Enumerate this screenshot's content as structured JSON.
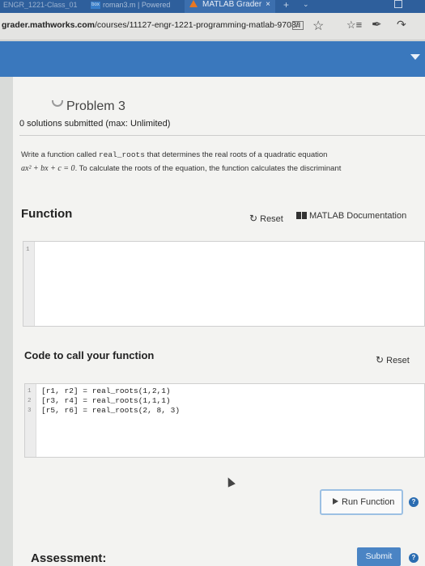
{
  "browser": {
    "tabs": [
      {
        "label": "ENGR_1221-Class_01"
      },
      {
        "icon_label": "box",
        "label": "roman3.m | Powered"
      },
      {
        "label": "MATLAB Grader"
      }
    ],
    "active_tab_close": "×",
    "new_tab": "+",
    "url_host": "grader.mathworks.com",
    "url_path": "/courses/11127-engr-1221-programming-matlab-9708/i"
  },
  "problem": {
    "title": "Problem 3",
    "solutions": "0 solutions submitted (max: Unlimited)",
    "description_prefix": "Write a function called ",
    "function_name": "real_roots",
    "description_suffix": " that determines the real roots of a quadratic equation",
    "equation": "ax² + bx + c = 0",
    "description_line2": ". To calculate the roots of the equation, the function calculates the discriminant"
  },
  "function_section": {
    "title": "Function",
    "reset_label": "Reset",
    "docs_label": "MATLAB Documentation",
    "line_numbers": [
      "1"
    ]
  },
  "call_section": {
    "title": "Code to call your function",
    "reset_label": "Reset",
    "lines": [
      {
        "num": "1",
        "code": "[r1, r2] = real_roots(1,2,1)"
      },
      {
        "num": "2",
        "code": "[r3, r4] = real_roots(1,1,1)"
      },
      {
        "num": "3",
        "code": "[r5, r6] = real_roots(2, 8, 3)"
      }
    ]
  },
  "actions": {
    "run_label": "Run Function",
    "help": "?"
  },
  "assessment": {
    "title": "Assessment:",
    "submit_label": "Submit"
  },
  "colors": {
    "header_blue": "#3a78bd",
    "tabstrip_blue": "#2e5f9c",
    "submit_blue": "#4a84c4",
    "help_blue": "#2a6cb1"
  },
  "icons": [
    "shield-icon",
    "reader-view-icon",
    "favorite-star-icon",
    "favorites-list-icon",
    "pen-icon",
    "share-icon",
    "reset-icon",
    "book-icon",
    "play-icon",
    "help-icon",
    "mouse-cursor-icon"
  ]
}
